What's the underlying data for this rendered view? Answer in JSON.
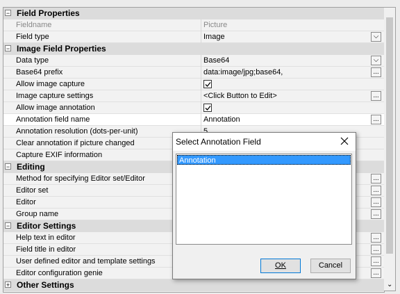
{
  "grid": {
    "rows": [
      {
        "kind": "cat",
        "toggle": "⊟",
        "label": "Field Properties"
      },
      {
        "kind": "prop",
        "name": "Fieldname",
        "value": "Picture",
        "disabled": true
      },
      {
        "kind": "prop",
        "name": "Field type",
        "value": "Image",
        "btn": "dropdown"
      },
      {
        "kind": "cat",
        "toggle": "⊟",
        "label": "Image Field Properties"
      },
      {
        "kind": "prop",
        "name": "Data type",
        "value": "Base64",
        "btn": "dropdown"
      },
      {
        "kind": "prop",
        "name": "Base64 prefix",
        "value": "data:image/jpg;base64,",
        "btn": "ellipsis"
      },
      {
        "kind": "prop",
        "name": "Allow image capture",
        "value": "",
        "check": true
      },
      {
        "kind": "prop",
        "name": "Image capture settings",
        "value": "<Click Button to Edit>",
        "btn": "ellipsis"
      },
      {
        "kind": "prop",
        "name": "Allow image annotation",
        "value": "",
        "check": true
      },
      {
        "kind": "prop",
        "name": "Annotation field name",
        "value": "Annotation",
        "btn": "ellipsis",
        "selected": true
      },
      {
        "kind": "prop",
        "name": "Annotation resolution (dots-per-unit)",
        "value": "5"
      },
      {
        "kind": "prop",
        "name": "Clear annotation if picture changed",
        "value": ""
      },
      {
        "kind": "prop",
        "name": "Capture EXIF information",
        "value": ""
      },
      {
        "kind": "cat",
        "toggle": "⊟",
        "label": "Editing"
      },
      {
        "kind": "prop",
        "name": "Method for specifying Editor set/Editor",
        "value": "",
        "btn": "ellipsis"
      },
      {
        "kind": "prop",
        "name": "Editor set",
        "value": "",
        "btn": "ellipsis"
      },
      {
        "kind": "prop",
        "name": "Editor",
        "value": "",
        "btn": "ellipsis"
      },
      {
        "kind": "prop",
        "name": "Group name",
        "value": "",
        "btn": "ellipsis"
      },
      {
        "kind": "cat",
        "toggle": "⊟",
        "label": "Editor Settings"
      },
      {
        "kind": "prop",
        "name": "Help text in editor",
        "value": "",
        "btn": "ellipsis"
      },
      {
        "kind": "prop",
        "name": "Field title in editor",
        "value": "",
        "btn": "ellipsis"
      },
      {
        "kind": "prop",
        "name": "User defined editor and template settings",
        "value": "",
        "btn": "ellipsis"
      },
      {
        "kind": "prop",
        "name": "Editor configuration genie",
        "value": "",
        "btn": "ellipsis"
      },
      {
        "kind": "cat",
        "toggle": "⊞",
        "label": "Other Settings"
      }
    ]
  },
  "icons": {
    "dropdown": "chevron-down-icon",
    "ellipsis": "ellipsis-icon",
    "check": "checkmark-icon",
    "close": "close-icon"
  },
  "glyphs": {
    "dropdown": "⌵",
    "ellipsis": "...",
    "scroll_down": "⌄"
  },
  "dialog": {
    "title": "Select Annotation Field",
    "items": [
      "Annotation"
    ],
    "ok_label": "OK",
    "cancel_label": "Cancel"
  },
  "colors": {
    "selection": "#3399ff",
    "category": "#dcdcdc"
  }
}
